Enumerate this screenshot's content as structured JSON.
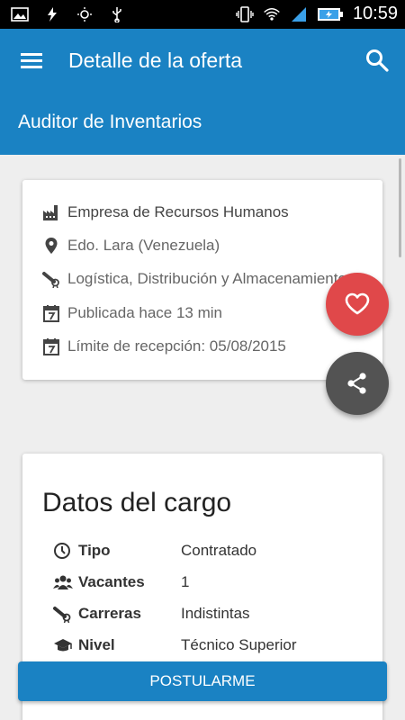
{
  "statusbar": {
    "time": "10:59",
    "icons_left": [
      "image-icon",
      "bolt-icon",
      "brightness-icon",
      "usb-icon"
    ],
    "icons_right": [
      "vibrate-icon",
      "wifi-icon",
      "signal-icon",
      "battery-icon"
    ]
  },
  "appbar": {
    "title": "Detalle de la oferta",
    "subtitle": "Auditor de Inventarios",
    "color": "#1a82c3"
  },
  "offer": {
    "company": "Empresa de Recursos Humanos",
    "location": "Edo. Lara (Venezuela)",
    "area": "Logística, Distribución y Almacenamiento",
    "published": "Publicada hace 13 min",
    "deadline": "Límite de recepción: 05/08/2015"
  },
  "fabs": {
    "favorite_color": "#e0484a",
    "share_color": "#535353",
    "favorite_icon": "heart-icon",
    "share_icon": "share-icon"
  },
  "details": {
    "heading": "Datos del cargo",
    "rows": [
      {
        "icon": "clock-icon",
        "label": "Tipo",
        "value": "Contratado"
      },
      {
        "icon": "group-icon",
        "label": "Vacantes",
        "value": "1"
      },
      {
        "icon": "diploma-icon",
        "label": "Carreras",
        "value": "Indistintas"
      },
      {
        "icon": "graduation-cap-icon",
        "label": "Nivel",
        "value": "Técnico Superior"
      }
    ]
  },
  "apply_label": "POSTULARME"
}
